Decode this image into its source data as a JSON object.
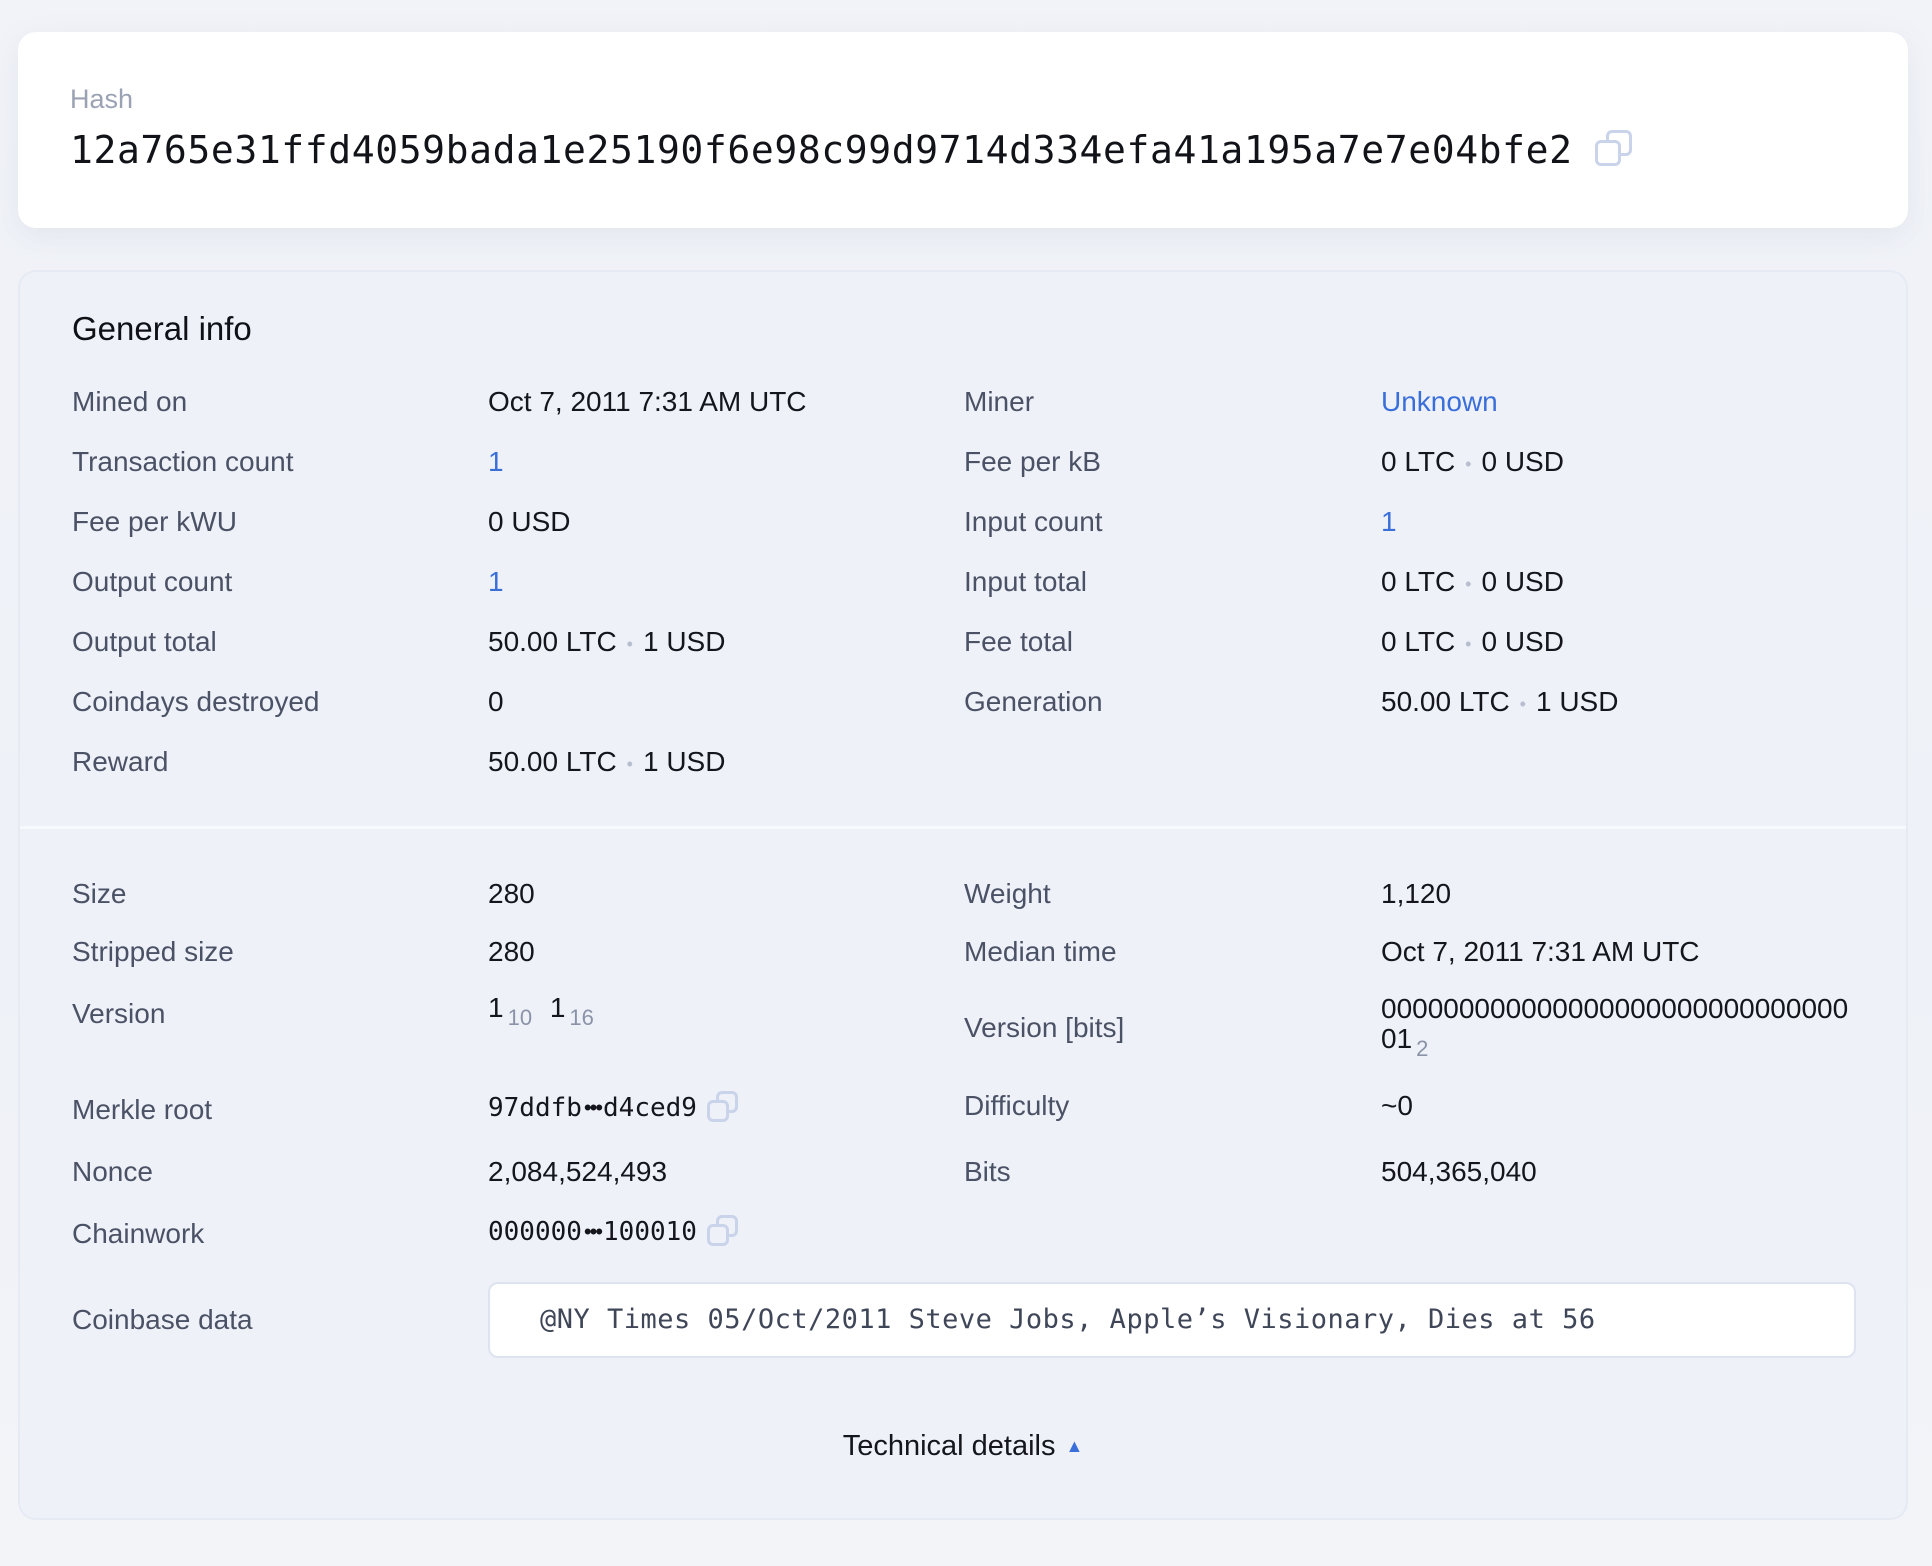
{
  "hash": {
    "label": "Hash",
    "value": "12a765e31ffd4059bada1e25190f6e98c99d9714d334efa41a195a7e7e04bfe2"
  },
  "general": {
    "title": "General info",
    "mined_on": {
      "label": "Mined on",
      "value": "Oct 7, 2011 7:31 AM UTC"
    },
    "miner": {
      "label": "Miner",
      "value": "Unknown"
    },
    "transaction_count": {
      "label": "Transaction count",
      "value": "1"
    },
    "fee_per_kb": {
      "label": "Fee per kB",
      "ltc": "0 LTC",
      "usd": "0 USD"
    },
    "fee_per_kwu": {
      "label": "Fee per kWU",
      "value": "0 USD"
    },
    "input_count": {
      "label": "Input count",
      "value": "1"
    },
    "output_count": {
      "label": "Output count",
      "value": "1"
    },
    "input_total": {
      "label": "Input total",
      "ltc": "0 LTC",
      "usd": "0 USD"
    },
    "output_total": {
      "label": "Output total",
      "ltc": "50.00 LTC",
      "usd": "1 USD"
    },
    "fee_total": {
      "label": "Fee total",
      "ltc": "0 LTC",
      "usd": "0 USD"
    },
    "coindays_destroyed": {
      "label": "Coindays destroyed",
      "value": "0"
    },
    "generation": {
      "label": "Generation",
      "ltc": "50.00 LTC",
      "usd": "1 USD"
    },
    "reward": {
      "label": "Reward",
      "ltc": "50.00 LTC",
      "usd": "1 USD"
    },
    "separator": "•"
  },
  "technical": {
    "size": {
      "label": "Size",
      "value": "280"
    },
    "weight": {
      "label": "Weight",
      "value": "1,120"
    },
    "stripped_size": {
      "label": "Stripped size",
      "value": "280"
    },
    "median_time": {
      "label": "Median time",
      "value": "Oct 7, 2011 7:31 AM UTC"
    },
    "version": {
      "label": "Version",
      "dec": "1",
      "dec_base": "10",
      "hex": "1",
      "hex_base": "16"
    },
    "version_bits": {
      "label": "Version [bits]",
      "value": "00000000000000000000000000000001",
      "base": "2"
    },
    "merkle_root": {
      "label": "Merkle root",
      "start": "97ddfb",
      "dots": "•••",
      "end": "d4ced9"
    },
    "difficulty": {
      "label": "Difficulty",
      "value": "~0"
    },
    "nonce": {
      "label": "Nonce",
      "value": "2,084,524,493"
    },
    "bits": {
      "label": "Bits",
      "value": "504,365,040"
    },
    "chainwork": {
      "label": "Chainwork",
      "start": "000000",
      "dots": "•••",
      "end": "100010"
    },
    "coinbase_data": {
      "label": "Coinbase data",
      "value": "@NY Times 05/Oct/2011 Steve Jobs, Apple’s Visionary, Dies at 56"
    },
    "toggle_label": "Technical details",
    "toggle_icon": "▲"
  }
}
